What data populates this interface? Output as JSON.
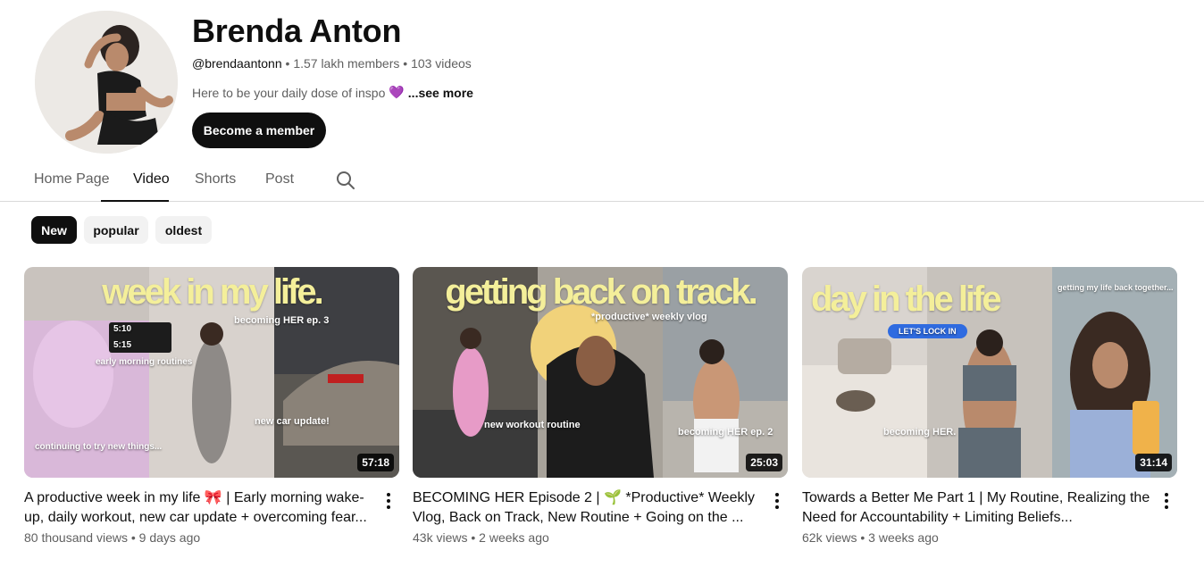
{
  "channel": {
    "name": "Brenda Anton",
    "handle": "@brendaantonn",
    "members": "1.57 lakh members",
    "videos_count": "103 videos",
    "separator": "•",
    "description": "Here to be your daily dose of inspo",
    "description_emoji": "💜",
    "see_more": "...see more",
    "member_button": "Become a member"
  },
  "tabs": [
    {
      "label": "Home Page",
      "active": false
    },
    {
      "label": "Video",
      "active": true
    },
    {
      "label": "Shorts",
      "active": false
    },
    {
      "label": "Post",
      "active": false
    }
  ],
  "chips": [
    {
      "label": "New",
      "active": true
    },
    {
      "label": "popular",
      "active": false
    },
    {
      "label": "oldest",
      "active": false
    }
  ],
  "videos": [
    {
      "thumb_title": "week in my life.",
      "thumb_labels": [
        "becoming HER ep. 3",
        "early morning routines",
        "new car update!",
        "continuing to try new things...",
        "5:10",
        "5:15"
      ],
      "duration": "57:18",
      "title": "A productive week in my life 🎀 | Early morning wake-up, daily workout, new car update + overcoming fear...",
      "views": "80 thousand views",
      "age": "9 days ago"
    },
    {
      "thumb_title": "getting back on track.",
      "thumb_labels": [
        "*productive* weekly vlog",
        "new workout routine",
        "becoming HER ep. 2"
      ],
      "duration": "25:03",
      "title": "BECOMING HER Episode 2 | 🌱 *Productive* Weekly Vlog, Back on Track, New Routine + Going on the ...",
      "views": "43k views",
      "age": "2 weeks ago"
    },
    {
      "thumb_title": "day in the life",
      "thumb_labels": [
        "getting my life back together...",
        "LET'S LOCK IN",
        "becoming HER."
      ],
      "duration": "31:14",
      "title": "Towards a Better Me Part 1 | My Routine, Realizing the Need for Accountability + Limiting Beliefs...",
      "views": "62k views",
      "age": "3 weeks ago"
    }
  ],
  "colors": {
    "text_primary": "#0f0f0f",
    "text_secondary": "#606060",
    "chip_bg": "#f2f2f2",
    "thumb_title_yellow": "#f4ef9a"
  }
}
